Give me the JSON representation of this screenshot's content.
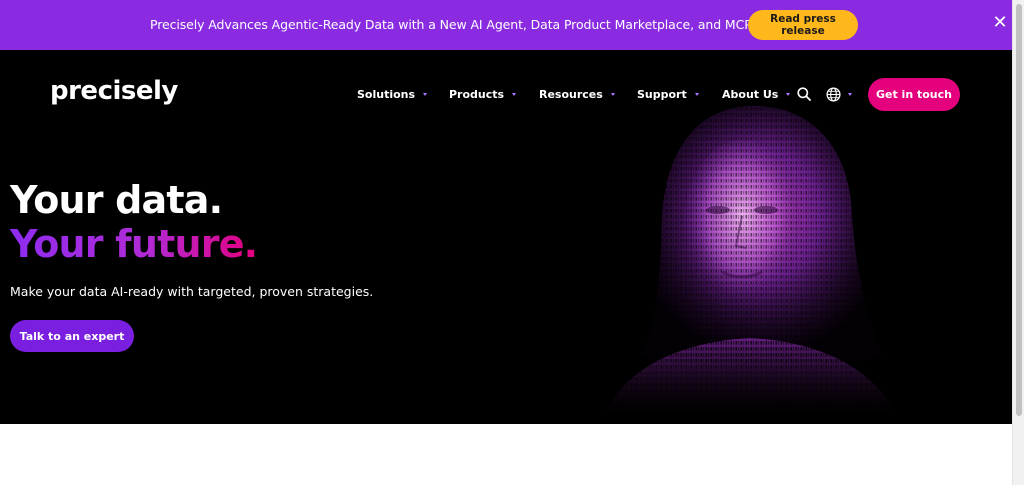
{
  "announcement": {
    "text": "Precisely Advances Agentic-Ready Data with a New AI Agent, Data Product Marketplace, and MCP-Enabled APIs",
    "button_label": "Read press release",
    "close_glyph": "✕"
  },
  "header": {
    "logo_text": "precisely",
    "nav": [
      {
        "label": "Solutions"
      },
      {
        "label": "Products"
      },
      {
        "label": "Resources"
      },
      {
        "label": "Support"
      },
      {
        "label": "About Us"
      }
    ],
    "search_icon": "search-icon",
    "language_icon": "globe-icon",
    "cta_label": "Get in touch"
  },
  "hero": {
    "headline_1": "Your data.",
    "headline_2": "Your future.",
    "subtext": "Make your data AI-ready with targeted, proven strategies.",
    "cta_label": "Talk to an expert",
    "image": "binary-portrait"
  },
  "colors": {
    "announcement_bg": "#8a2be2",
    "announcement_button": "#ffb81c",
    "hero_bg": "#000000",
    "cta_pink": "#e5007e",
    "cta_purple": "#7a1fe0",
    "caret": "#a874ff"
  }
}
